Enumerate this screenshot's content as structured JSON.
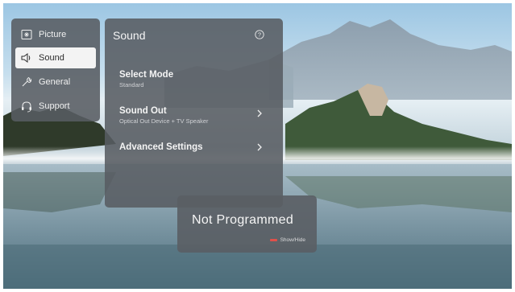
{
  "menu": {
    "items": [
      {
        "label": "Picture",
        "icon": "picture-icon"
      },
      {
        "label": "Sound",
        "icon": "speaker-icon",
        "selected": true
      },
      {
        "label": "General",
        "icon": "wrench-icon"
      },
      {
        "label": "Support",
        "icon": "headset-icon"
      }
    ]
  },
  "sound_panel": {
    "title": "Sound",
    "help_icon": "question-icon",
    "settings": [
      {
        "label": "Select Mode",
        "value": "Standard"
      },
      {
        "label": "Sound Out",
        "value": "Optical Out Device + TV Speaker",
        "icon": "chevron-right-icon"
      },
      {
        "label": "Advanced Settings",
        "icon": "chevron-right-icon"
      }
    ]
  },
  "status_card": {
    "title": "Not Programmed",
    "hint": "Show/Hide",
    "hint_key_color": "#e0504a"
  }
}
